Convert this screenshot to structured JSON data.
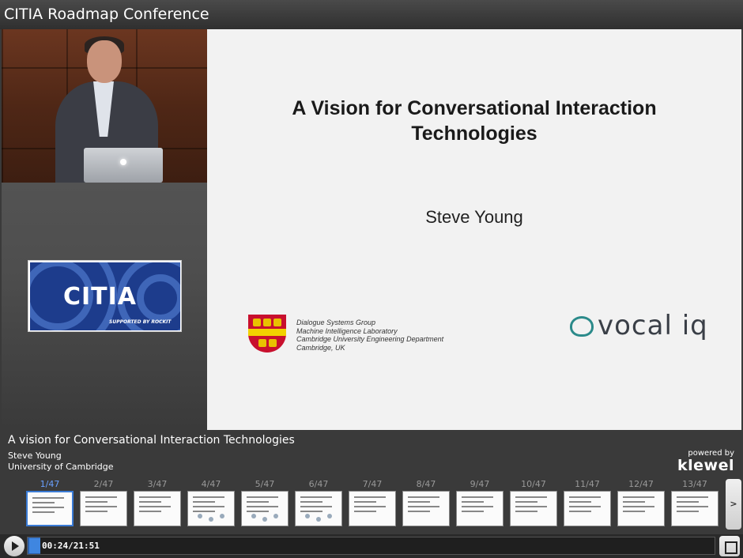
{
  "window": {
    "title": "CITIA Roadmap Conference"
  },
  "logo": {
    "brand": "CITIA",
    "tagline": "SUPPORTED BY ROCKIT"
  },
  "slide": {
    "title_line1": "A Vision for Conversational Interaction",
    "title_line2": "Technologies",
    "author": "Steve Young",
    "affiliation": [
      "Dialogue Systems Group",
      "Machine Intelligence Laboratory",
      "Cambridge University Engineering Department",
      "Cambridge, UK"
    ],
    "partner_logo": "vocal iq"
  },
  "talk": {
    "title": "A vision for Conversational Interaction Technologies",
    "speaker": "Steve Young",
    "institution": "University of Cambridge"
  },
  "branding": {
    "powered_by": "powered by",
    "name": "klewel"
  },
  "thumbnails": [
    {
      "label": "1/47"
    },
    {
      "label": "2/47"
    },
    {
      "label": "3/47"
    },
    {
      "label": "4/47"
    },
    {
      "label": "5/47"
    },
    {
      "label": "6/47"
    },
    {
      "label": "7/47"
    },
    {
      "label": "8/47"
    },
    {
      "label": "9/47"
    },
    {
      "label": "10/47"
    },
    {
      "label": "11/47"
    },
    {
      "label": "12/47"
    },
    {
      "label": "13/47"
    }
  ],
  "thumbnails_active_index": 0,
  "player": {
    "time": "00:24/21:51",
    "progress": 0.018,
    "next_label": ">"
  },
  "colors": {
    "accent": "#3a7bd5",
    "active_thumb_label": "#6aa0ff",
    "vocal_teal": "#2b8a8a",
    "crest_red": "#c8102e"
  }
}
